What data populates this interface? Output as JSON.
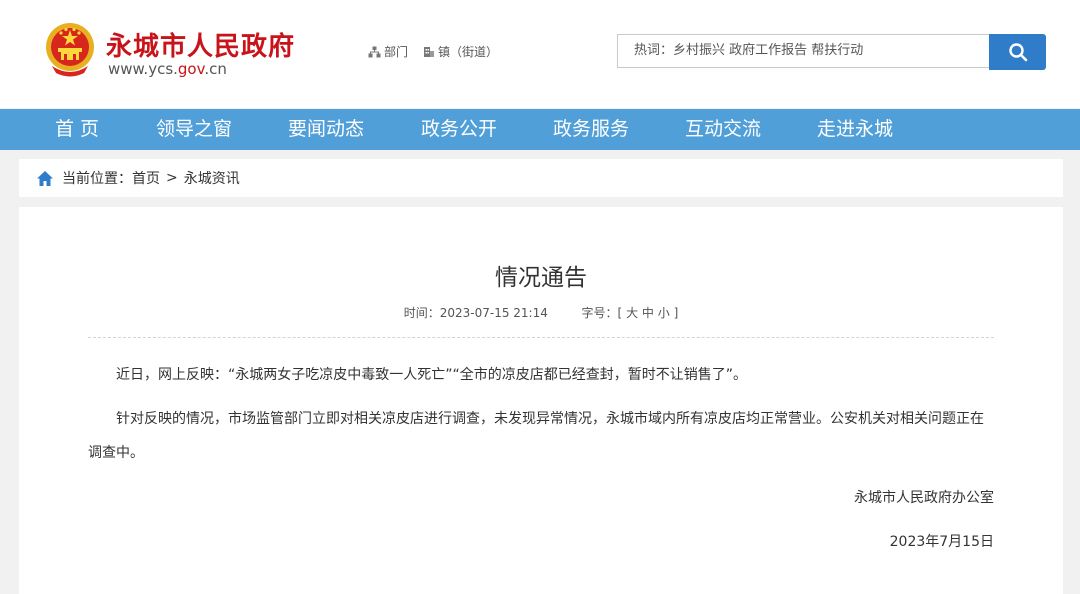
{
  "header": {
    "site_title": "永城市人民政府",
    "url_prefix": "www.ycs.",
    "url_highlight": "gov",
    "url_suffix": ".cn",
    "links": [
      {
        "label": "部门",
        "icon": "org-chart-icon"
      },
      {
        "label": "镇（街道）",
        "icon": "building-icon"
      }
    ],
    "search": {
      "text": "热词：乡村振兴  政府工作报告  帮扶行动",
      "button_icon": "search-icon"
    }
  },
  "nav": {
    "items": [
      "首 页",
      "领导之窗",
      "要闻动态",
      "政务公开",
      "政务服务",
      "互动交流",
      "走进永城"
    ]
  },
  "breadcrumb": {
    "prefix": "当前位置：",
    "home": "首页",
    "separator": ">",
    "current": "永城资讯"
  },
  "article": {
    "title": "情况通告",
    "time_label": "时间：",
    "time": "2023-07-15 21:14",
    "font_label": "字号：",
    "font_open": "[",
    "font_large": "大",
    "font_medium": "中",
    "font_small": "小",
    "font_close": "]",
    "paragraphs": [
      "近日，网上反映：“永城两女子吃凉皮中毒致一人死亡”“全市的凉皮店都已经查封，暂时不让销售了”。",
      "针对反映的情况，市场监管部门立即对相关凉皮店进行调查，未发现异常情况，永城市域内所有凉皮店均正常营业。公安机关对相关问题正在调查中。"
    ],
    "signature": "永城市人民政府办公室",
    "date": "2023年7月15日"
  },
  "colors": {
    "brand_red": "#c8131a",
    "nav_blue": "#519fd9",
    "button_blue": "#2f7dc9"
  }
}
